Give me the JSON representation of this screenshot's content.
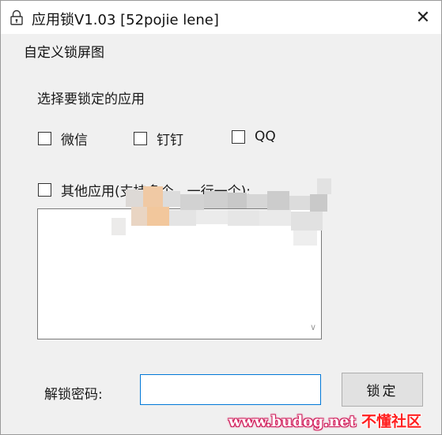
{
  "window": {
    "title": "应用锁V1.03 [52pojie lene]"
  },
  "menu": {
    "items": [
      "自定义锁屏图"
    ]
  },
  "main": {
    "section_label": "选择要锁定的应用",
    "apps": [
      {
        "label": "微信",
        "checked": false
      },
      {
        "label": "钉钉",
        "checked": false
      },
      {
        "label": "QQ",
        "checked": false
      }
    ],
    "other_apps": {
      "label": "其他应用(支持多个，一行一个):",
      "checked": false
    },
    "textarea_value": "",
    "password_label": "解锁密码:",
    "password_value": "",
    "lock_button": "锁定"
  },
  "watermark": {
    "url": "www.budog.net",
    "site": "不懂社区"
  },
  "colors": {
    "input_focus_border": "#0078d7",
    "window_bg": "#f0f0f0",
    "watermark_red": "#ff2020"
  }
}
